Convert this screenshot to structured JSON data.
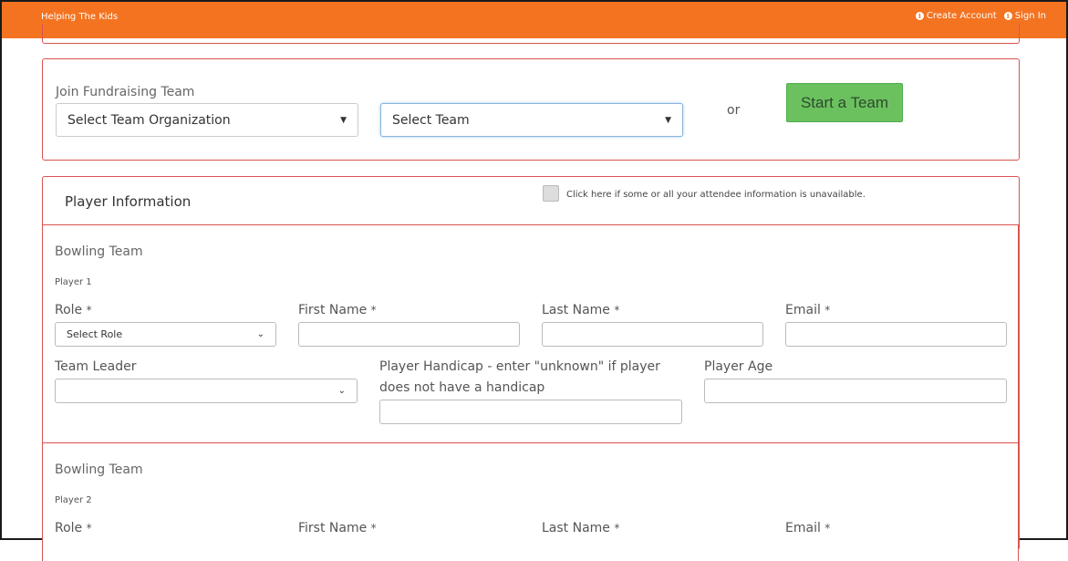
{
  "navbar": {
    "brand": "Helping The Kids",
    "create_account": "Create Account",
    "sign_in": "Sign In"
  },
  "join": {
    "label": "Join Fundraising Team",
    "org_select": "Select Team Organization",
    "team_select": "Select Team",
    "or": "or",
    "start_button": "Start a Team"
  },
  "player_info": {
    "title": "Player Information",
    "unavailable_label": "Click here if some or all your attendee information is unavailable.",
    "players": [
      {
        "team": "Bowling Team",
        "number": "Player 1",
        "role_label": "Role",
        "role_value": "Select Role",
        "first_name_label": "First Name",
        "last_name_label": "Last Name",
        "email_label": "Email",
        "team_leader_label": "Team Leader",
        "handicap_label": "Player Handicap - enter \"unknown\" if player does not have a handicap",
        "age_label": "Player Age"
      },
      {
        "team": "Bowling Team",
        "number": "Player 2",
        "role_label": "Role",
        "first_name_label": "First Name",
        "last_name_label": "Last Name",
        "email_label": "Email"
      }
    ],
    "required_mark": "*"
  }
}
